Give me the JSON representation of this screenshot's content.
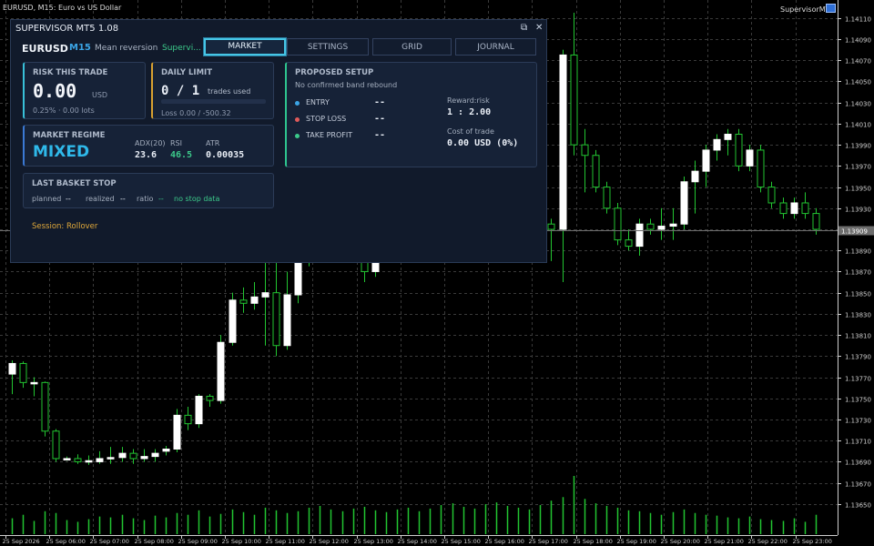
{
  "chart_header": {
    "symbol_info": "EURUSD, M15:  Euro vs US Dollar",
    "ea_name": "SupervisorMT5",
    "ea_icon": "hat-icon"
  },
  "panel": {
    "title": "SUPERVISOR MT5  1.08",
    "restore_icon": "⧉",
    "close_icon": "✕",
    "symbol": "EURUSD",
    "timeframe": "M15",
    "strategy": "Mean reversion",
    "status": "Supervi...",
    "tabs": [
      {
        "label": "MARKET",
        "active": true
      },
      {
        "label": "SETTINGS",
        "active": false
      },
      {
        "label": "GRID",
        "active": false
      },
      {
        "label": "JOURNAL",
        "active": false
      }
    ],
    "risk": {
      "label": "RISK THIS TRADE",
      "value": "0.00",
      "unit": "USD",
      "detail": "0.25%  ·  0.00 lots"
    },
    "daily": {
      "label": "DAILY LIMIT",
      "count": "0 / 1",
      "unit": "trades used",
      "loss": "Loss  0.00 / -500.32",
      "progress": 0
    },
    "regime": {
      "label": "MARKET REGIME",
      "value": "MIXED",
      "adx_label": "ADX(20)",
      "adx": "23.6",
      "rsi_label": "RSI",
      "rsi": "46.5",
      "atr_label": "ATR",
      "atr": "0.00035"
    },
    "basket": {
      "label": "LAST BASKET STOP",
      "planned_label": "planned",
      "planned": "--",
      "realized_label": "realized",
      "realized": "--",
      "ratio_label": "ratio",
      "ratio": "--",
      "note": "no stop data"
    },
    "setup": {
      "label": "PROPOSED SETUP",
      "subtitle": "No confirmed band rebound",
      "entry_label": "ENTRY",
      "entry": "--",
      "sl_label": "STOP LOSS",
      "sl": "--",
      "tp_label": "TAKE PROFIT",
      "tp": "--",
      "rr_label": "Reward:risk",
      "rr": "1 : 2.00",
      "cost_label": "Cost of trade",
      "cost": "0.00 USD  (0%)"
    },
    "session": "Session: Rollover"
  },
  "colors": {
    "accent": "#46c6e6",
    "positive": "#3cc98a",
    "negative": "#e05a5a",
    "warning": "#e0a83a",
    "candle_up_fill": "#ffffff",
    "candle_wick": "#22c531"
  },
  "chart_data": {
    "type": "candlestick",
    "symbol": "EURUSD",
    "timeframe": "M15",
    "current_price": "1.13909",
    "y_ticks": [
      "1.14110",
      "1.14090",
      "1.14070",
      "1.14050",
      "1.14030",
      "1.14010",
      "1.13990",
      "1.13970",
      "1.13950",
      "1.13930",
      "1.13910",
      "1.13890",
      "1.13870",
      "1.13850",
      "1.13830",
      "1.13810",
      "1.13790",
      "1.13770",
      "1.13750",
      "1.13730",
      "1.13710",
      "1.13690",
      "1.13670",
      "1.13650"
    ],
    "ylim": [
      1.13643,
      1.14115
    ],
    "x_ticks": [
      "25 Sep 2026",
      "25 Sep 06:00",
      "25 Sep 07:00",
      "25 Sep 08:00",
      "25 Sep 09:00",
      "25 Sep 10:00",
      "25 Sep 11:00",
      "25 Sep 12:00",
      "25 Sep 13:00",
      "25 Sep 14:00",
      "25 Sep 15:00",
      "25 Sep 16:00",
      "25 Sep 17:00",
      "25 Sep 18:00",
      "25 Sep 19:00",
      "25 Sep 20:00",
      "25 Sep 21:00",
      "25 Sep 22:00",
      "25 Sep 23:00"
    ],
    "candles": [
      {
        "o": 1.13773,
        "h": 1.13786,
        "l": 1.13754,
        "c": 1.13783
      },
      {
        "o": 1.13783,
        "h": 1.13785,
        "l": 1.1376,
        "c": 1.13765
      },
      {
        "o": 1.13765,
        "h": 1.1377,
        "l": 1.13752,
        "c": 1.13765
      },
      {
        "o": 1.13765,
        "h": 1.13766,
        "l": 1.13714,
        "c": 1.13719
      },
      {
        "o": 1.13719,
        "h": 1.13721,
        "l": 1.1369,
        "c": 1.13693
      },
      {
        "o": 1.13693,
        "h": 1.13695,
        "l": 1.13691,
        "c": 1.13693
      },
      {
        "o": 1.13693,
        "h": 1.13697,
        "l": 1.13688,
        "c": 1.1369
      },
      {
        "o": 1.1369,
        "h": 1.13696,
        "l": 1.13687,
        "c": 1.13691
      },
      {
        "o": 1.1369,
        "h": 1.137,
        "l": 1.13688,
        "c": 1.13693
      },
      {
        "o": 1.13693,
        "h": 1.13704,
        "l": 1.13688,
        "c": 1.13694
      },
      {
        "o": 1.13694,
        "h": 1.13704,
        "l": 1.1369,
        "c": 1.13698
      },
      {
        "o": 1.13698,
        "h": 1.13702,
        "l": 1.13688,
        "c": 1.13693
      },
      {
        "o": 1.13693,
        "h": 1.13702,
        "l": 1.1369,
        "c": 1.13695
      },
      {
        "o": 1.13695,
        "h": 1.13702,
        "l": 1.1369,
        "c": 1.13698
      },
      {
        "o": 1.137,
        "h": 1.13705,
        "l": 1.13696,
        "c": 1.13702
      },
      {
        "o": 1.13702,
        "h": 1.1374,
        "l": 1.13699,
        "c": 1.13734
      },
      {
        "o": 1.13734,
        "h": 1.13742,
        "l": 1.1372,
        "c": 1.13726
      },
      {
        "o": 1.13726,
        "h": 1.13754,
        "l": 1.13722,
        "c": 1.13752
      },
      {
        "o": 1.13752,
        "h": 1.13754,
        "l": 1.13742,
        "c": 1.13748
      },
      {
        "o": 1.13748,
        "h": 1.1381,
        "l": 1.13745,
        "c": 1.13803
      },
      {
        "o": 1.13803,
        "h": 1.1385,
        "l": 1.138,
        "c": 1.13843
      },
      {
        "o": 1.13843,
        "h": 1.13855,
        "l": 1.13831,
        "c": 1.1384
      },
      {
        "o": 1.1384,
        "h": 1.1386,
        "l": 1.13834,
        "c": 1.13846
      },
      {
        "o": 1.13846,
        "h": 1.1388,
        "l": 1.138,
        "c": 1.1385
      },
      {
        "o": 1.1385,
        "h": 1.1388,
        "l": 1.1379,
        "c": 1.138
      },
      {
        "o": 1.138,
        "h": 1.1387,
        "l": 1.13796,
        "c": 1.13848
      },
      {
        "o": 1.13848,
        "h": 1.139,
        "l": 1.1384,
        "c": 1.1388
      },
      {
        "o": 1.1388,
        "h": 1.1398,
        "l": 1.13875,
        "c": 1.13975
      },
      {
        "o": 1.13975,
        "h": 1.1401,
        "l": 1.13955,
        "c": 1.1399
      },
      {
        "o": 1.1399,
        "h": 1.1401,
        "l": 1.13958,
        "c": 1.1398
      },
      {
        "o": 1.1398,
        "h": 1.14,
        "l": 1.1396,
        "c": 1.13985
      },
      {
        "o": 1.13985,
        "h": 1.1402,
        "l": 1.139,
        "c": 1.13905
      },
      {
        "o": 1.13905,
        "h": 1.1392,
        "l": 1.1386,
        "c": 1.1387
      },
      {
        "o": 1.1387,
        "h": 1.1392,
        "l": 1.13865,
        "c": 1.1391
      },
      {
        "o": 1.1391,
        "h": 1.1396,
        "l": 1.139,
        "c": 1.13955
      },
      {
        "o": 1.13955,
        "h": 1.1398,
        "l": 1.1393,
        "c": 1.1396
      },
      {
        "o": 1.1396,
        "h": 1.1399,
        "l": 1.1394,
        "c": 1.13975
      },
      {
        "o": 1.13975,
        "h": 1.1399,
        "l": 1.13955,
        "c": 1.13985
      },
      {
        "o": 1.13985,
        "h": 1.14,
        "l": 1.1396,
        "c": 1.13995
      },
      {
        "o": 1.13995,
        "h": 1.1401,
        "l": 1.13975,
        "c": 1.1398
      },
      {
        "o": 1.1398,
        "h": 1.14,
        "l": 1.13965,
        "c": 1.1399
      },
      {
        "o": 1.1399,
        "h": 1.14,
        "l": 1.1397,
        "c": 1.13975
      },
      {
        "o": 1.13975,
        "h": 1.1401,
        "l": 1.1394,
        "c": 1.13985
      },
      {
        "o": 1.13985,
        "h": 1.1401,
        "l": 1.1397,
        "c": 1.13998
      },
      {
        "o": 1.13998,
        "h": 1.1401,
        "l": 1.1398,
        "c": 1.14005
      },
      {
        "o": 1.14015,
        "h": 1.1403,
        "l": 1.13995,
        "c": 1.1402
      },
      {
        "o": 1.1402,
        "h": 1.1403,
        "l": 1.13965,
        "c": 1.1397
      },
      {
        "o": 1.1397,
        "h": 1.13975,
        "l": 1.1396,
        "c": 1.13965
      },
      {
        "o": 1.13965,
        "h": 1.1401,
        "l": 1.1391,
        "c": 1.13915
      },
      {
        "o": 1.13915,
        "h": 1.1392,
        "l": 1.1388,
        "c": 1.1391
      },
      {
        "o": 1.1391,
        "h": 1.1408,
        "l": 1.1386,
        "c": 1.14075
      },
      {
        "o": 1.14075,
        "h": 1.14115,
        "l": 1.1398,
        "c": 1.1399
      },
      {
        "o": 1.1399,
        "h": 1.14005,
        "l": 1.13945,
        "c": 1.1398
      },
      {
        "o": 1.1398,
        "h": 1.13985,
        "l": 1.13945,
        "c": 1.1395
      },
      {
        "o": 1.1395,
        "h": 1.13955,
        "l": 1.13925,
        "c": 1.1393
      },
      {
        "o": 1.1393,
        "h": 1.13935,
        "l": 1.13895,
        "c": 1.139
      },
      {
        "o": 1.139,
        "h": 1.1391,
        "l": 1.1389,
        "c": 1.13894
      },
      {
        "o": 1.13894,
        "h": 1.1392,
        "l": 1.13885,
        "c": 1.13915
      },
      {
        "o": 1.13915,
        "h": 1.1392,
        "l": 1.13905,
        "c": 1.1391
      },
      {
        "o": 1.1391,
        "h": 1.1393,
        "l": 1.139,
        "c": 1.13913
      },
      {
        "o": 1.13913,
        "h": 1.1393,
        "l": 1.139,
        "c": 1.13915
      },
      {
        "o": 1.13915,
        "h": 1.1396,
        "l": 1.1391,
        "c": 1.13955
      },
      {
        "o": 1.13955,
        "h": 1.13975,
        "l": 1.13925,
        "c": 1.13965
      },
      {
        "o": 1.13965,
        "h": 1.1399,
        "l": 1.1395,
        "c": 1.13985
      },
      {
        "o": 1.13985,
        "h": 1.14,
        "l": 1.13975,
        "c": 1.13995
      },
      {
        "o": 1.13995,
        "h": 1.14005,
        "l": 1.1398,
        "c": 1.14
      },
      {
        "o": 1.14,
        "h": 1.14005,
        "l": 1.13965,
        "c": 1.1397
      },
      {
        "o": 1.1397,
        "h": 1.1399,
        "l": 1.13965,
        "c": 1.13985
      },
      {
        "o": 1.13985,
        "h": 1.1399,
        "l": 1.13945,
        "c": 1.1395
      },
      {
        "o": 1.1395,
        "h": 1.13955,
        "l": 1.1393,
        "c": 1.13935
      },
      {
        "o": 1.13935,
        "h": 1.1394,
        "l": 1.1392,
        "c": 1.13925
      },
      {
        "o": 1.13925,
        "h": 1.1394,
        "l": 1.1392,
        "c": 1.13935
      },
      {
        "o": 1.13935,
        "h": 1.13945,
        "l": 1.1392,
        "c": 1.13925
      },
      {
        "o": 1.13925,
        "h": 1.1393,
        "l": 1.13905,
        "c": 1.1391
      }
    ],
    "volumes": [
      18,
      22,
      15,
      26,
      24,
      16,
      14,
      17,
      20,
      19,
      22,
      18,
      16,
      21,
      19,
      24,
      22,
      27,
      20,
      23,
      28,
      25,
      22,
      30,
      27,
      24,
      26,
      30,
      32,
      28,
      26,
      29,
      31,
      27,
      25,
      28,
      30,
      26,
      29,
      33,
      35,
      31,
      29,
      34,
      36,
      32,
      30,
      28,
      33,
      38,
      42,
      66,
      40,
      35,
      32,
      30,
      27,
      26,
      24,
      22,
      25,
      28,
      24,
      22,
      21,
      19,
      18,
      20,
      17,
      16,
      15,
      18,
      14,
      22
    ]
  }
}
